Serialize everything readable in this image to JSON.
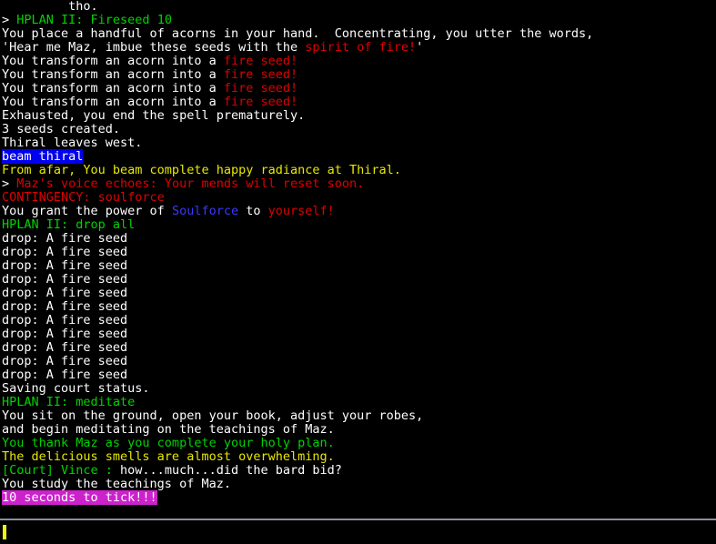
{
  "app": {
    "kind": "mud-telnet-client",
    "background_color": "#000000",
    "divider_color": "#8a8f9a",
    "cursor_color": "#f2f20c"
  },
  "palette": {
    "white": "#ffffff",
    "green": "#00d400",
    "red": "#e00000",
    "yellow": "#e8e800",
    "blue": "#3838ff",
    "highlight_blue_bg": "#0000ee",
    "highlight_magenta_bg": "#cc22cc"
  },
  "output": {
    "lines": [
      {
        "id": "line-0",
        "segments": [
          {
            "text": "         tho.",
            "color": "white"
          }
        ]
      },
      {
        "id": "line-1",
        "segments": [
          {
            "text": "> ",
            "color": "white"
          },
          {
            "text": "HPLAN II: Fireseed 10",
            "color": "green"
          }
        ]
      },
      {
        "id": "line-2",
        "segments": [
          {
            "text": "You place a handful of acorns in your hand.  Concentrating, you utter the words,",
            "color": "white"
          }
        ]
      },
      {
        "id": "line-3",
        "segments": [
          {
            "text": "'Hear me Maz, imbue these seeds with the ",
            "color": "white"
          },
          {
            "text": "spirit of fire!",
            "color": "red"
          },
          {
            "text": "'",
            "color": "white"
          }
        ]
      },
      {
        "id": "line-4",
        "segments": [
          {
            "text": "You transform an acorn into a ",
            "color": "white"
          },
          {
            "text": "fire seed!",
            "color": "red"
          }
        ]
      },
      {
        "id": "line-5",
        "segments": [
          {
            "text": "You transform an acorn into a ",
            "color": "white"
          },
          {
            "text": "fire seed!",
            "color": "red"
          }
        ]
      },
      {
        "id": "line-6",
        "segments": [
          {
            "text": "You transform an acorn into a ",
            "color": "white"
          },
          {
            "text": "fire seed!",
            "color": "red"
          }
        ]
      },
      {
        "id": "line-7",
        "segments": [
          {
            "text": "You transform an acorn into a ",
            "color": "white"
          },
          {
            "text": "fire seed!",
            "color": "red"
          }
        ]
      },
      {
        "id": "line-8",
        "segments": [
          {
            "text": "Exhausted, you end the spell prematurely.",
            "color": "white"
          }
        ]
      },
      {
        "id": "line-9",
        "segments": [
          {
            "text": "3 seeds created.",
            "color": "white"
          }
        ]
      },
      {
        "id": "line-10",
        "segments": [
          {
            "text": "Thiral leaves west.",
            "color": "white"
          }
        ]
      },
      {
        "id": "line-11",
        "segments": [
          {
            "text": "beam thiral",
            "color": "white",
            "highlight": "blue"
          }
        ]
      },
      {
        "id": "line-12",
        "segments": [
          {
            "text": "From afar, You beam complete happy radiance at Thiral.",
            "color": "yellow"
          }
        ]
      },
      {
        "id": "line-13",
        "segments": [
          {
            "text": "> ",
            "color": "white"
          },
          {
            "text": "Maz's voice echoes: Your mends will reset soon.",
            "color": "red"
          }
        ]
      },
      {
        "id": "line-14",
        "segments": [
          {
            "text": "CONTINGENCY: soulforce",
            "color": "red"
          }
        ]
      },
      {
        "id": "line-15",
        "segments": [
          {
            "text": "You grant the power of ",
            "color": "white"
          },
          {
            "text": "Soulforce",
            "color": "blue"
          },
          {
            "text": " to ",
            "color": "white"
          },
          {
            "text": "yourself!",
            "color": "red"
          }
        ]
      },
      {
        "id": "line-16",
        "segments": [
          {
            "text": "HPLAN II: drop all",
            "color": "green"
          }
        ]
      },
      {
        "id": "line-17",
        "segments": [
          {
            "text": "drop: A fire seed",
            "color": "white"
          }
        ]
      },
      {
        "id": "line-18",
        "segments": [
          {
            "text": "drop: A fire seed",
            "color": "white"
          }
        ]
      },
      {
        "id": "line-19",
        "segments": [
          {
            "text": "drop: A fire seed",
            "color": "white"
          }
        ]
      },
      {
        "id": "line-20",
        "segments": [
          {
            "text": "drop: A fire seed",
            "color": "white"
          }
        ]
      },
      {
        "id": "line-21",
        "segments": [
          {
            "text": "drop: A fire seed",
            "color": "white"
          }
        ]
      },
      {
        "id": "line-22",
        "segments": [
          {
            "text": "drop: A fire seed",
            "color": "white"
          }
        ]
      },
      {
        "id": "line-23",
        "segments": [
          {
            "text": "drop: A fire seed",
            "color": "white"
          }
        ]
      },
      {
        "id": "line-24",
        "segments": [
          {
            "text": "drop: A fire seed",
            "color": "white"
          }
        ]
      },
      {
        "id": "line-25",
        "segments": [
          {
            "text": "drop: A fire seed",
            "color": "white"
          }
        ]
      },
      {
        "id": "line-26",
        "segments": [
          {
            "text": "drop: A fire seed",
            "color": "white"
          }
        ]
      },
      {
        "id": "line-27",
        "segments": [
          {
            "text": "drop: A fire seed",
            "color": "white"
          }
        ]
      },
      {
        "id": "line-28",
        "segments": [
          {
            "text": "Saving court status.",
            "color": "white"
          }
        ]
      },
      {
        "id": "line-29",
        "segments": [
          {
            "text": "HPLAN II: meditate",
            "color": "green"
          }
        ]
      },
      {
        "id": "line-30",
        "segments": [
          {
            "text": "You sit on the ground, open your book, adjust your robes,",
            "color": "white"
          }
        ]
      },
      {
        "id": "line-31",
        "segments": [
          {
            "text": "and begin meditating on the teachings of Maz.",
            "color": "white"
          }
        ]
      },
      {
        "id": "line-32",
        "segments": [
          {
            "text": "You thank Maz as you complete your holy plan.",
            "color": "green"
          }
        ]
      },
      {
        "id": "line-33",
        "segments": [
          {
            "text": "The delicious smells are almost overwhelming.",
            "color": "yellow"
          }
        ]
      },
      {
        "id": "line-34",
        "segments": [
          {
            "text": "[Court] Vince : ",
            "color": "green"
          },
          {
            "text": "how...much...did the bard bid?",
            "color": "white"
          }
        ]
      },
      {
        "id": "line-35",
        "segments": [
          {
            "text": "You study the teachings of Maz.",
            "color": "white"
          }
        ]
      },
      {
        "id": "line-36",
        "segments": [
          {
            "text": "10 seconds to tick!!!",
            "color": "white",
            "highlight": "magenta"
          }
        ]
      }
    ]
  },
  "input": {
    "value": "",
    "placeholder": ""
  }
}
